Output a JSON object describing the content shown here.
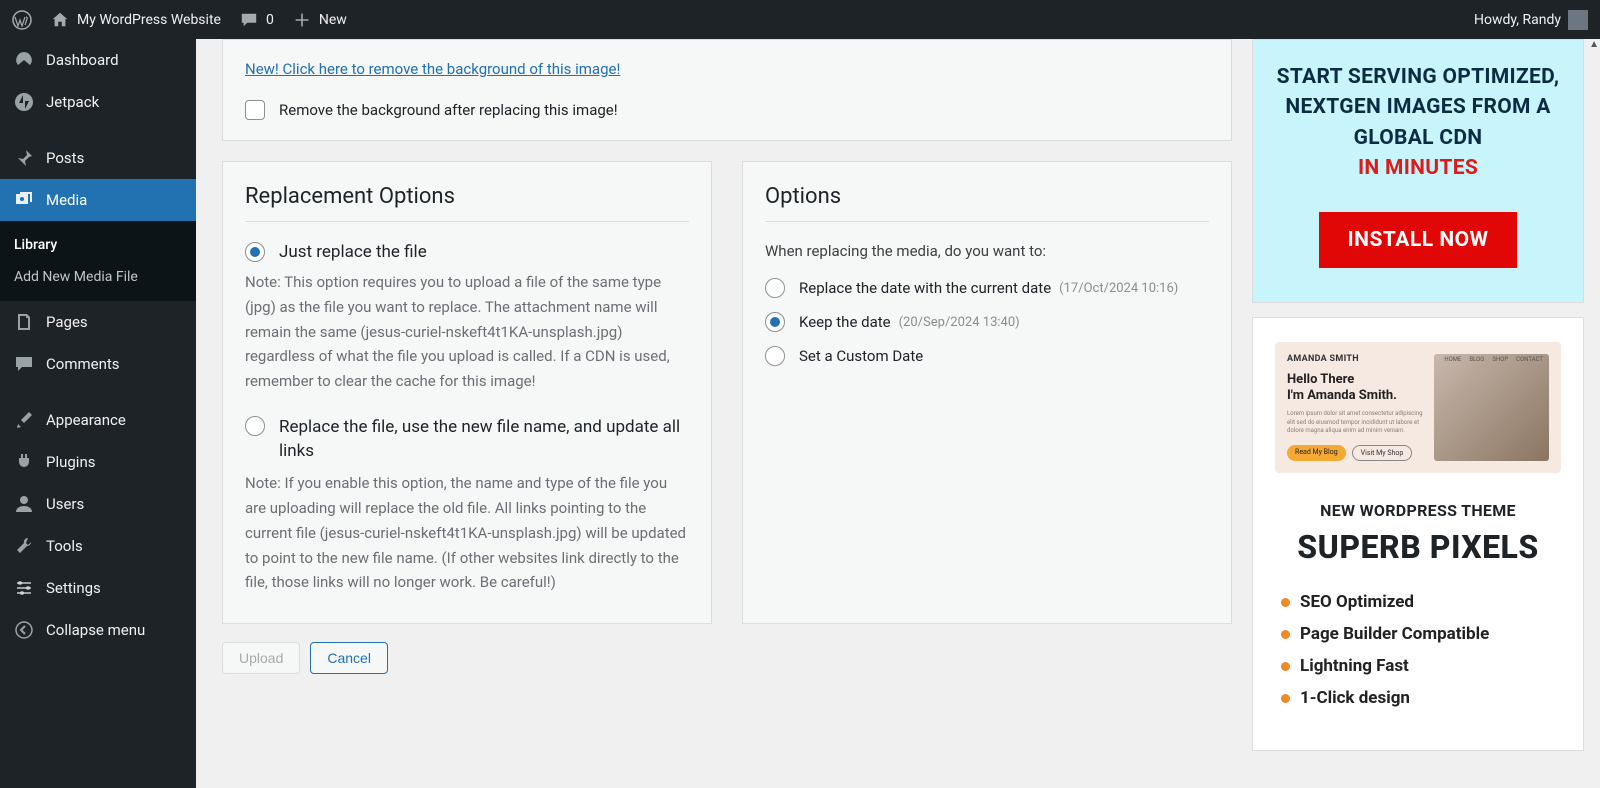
{
  "adminbar": {
    "site_name": "My WordPress Website",
    "comments_count": "0",
    "new_label": "New",
    "greeting": "Howdy, Randy"
  },
  "menu": {
    "dashboard": "Dashboard",
    "jetpack": "Jetpack",
    "posts": "Posts",
    "media": "Media",
    "media_sub_library": "Library",
    "media_sub_addnew": "Add New Media File",
    "pages": "Pages",
    "comments": "Comments",
    "appearance": "Appearance",
    "plugins": "Plugins",
    "users": "Users",
    "tools": "Tools",
    "settings": "Settings",
    "collapse": "Collapse menu"
  },
  "topbox": {
    "new_link": "New! Click here to remove the background of this image!",
    "remove_bg": "Remove the background after replacing this image!"
  },
  "replacement": {
    "heading": "Replacement Options",
    "opt1_label": "Just replace the file",
    "opt1_note": "Note: This option requires you to upload a file of the same type (jpg) as the file you want to replace. The attachment name will remain the same (jesus-curiel-nskeft4t1KA-unsplash.jpg) regardless of what the file you upload is called. If a CDN is used, remember to clear the cache for this image!",
    "opt2_label": "Replace the file, use the new file name, and update all links",
    "opt2_note": "Note: If you enable this option, the name and type of the file you are uploading will replace the old file. All links pointing to the current file (jesus-curiel-nskeft4t1KA-unsplash.jpg) will be updated to point to the new file name. (If other websites link directly to the file, those links will no longer work. Be careful!)"
  },
  "options": {
    "heading": "Options",
    "lead": "When replacing the media, do you want to:",
    "opt1": "Replace the date with the current date",
    "opt1_date": "(17/Oct/2024 10:16)",
    "opt2": "Keep the date",
    "opt2_date": "(20/Sep/2024 13:40)",
    "opt3": "Set a Custom Date"
  },
  "actions": {
    "upload": "Upload",
    "cancel": "Cancel"
  },
  "ad1": {
    "line1": "START SERVING OPTIMIZED, NEXTGEN IMAGES FROM A GLOBAL CDN",
    "line2": "IN MINUTES",
    "button": "INSTALL NOW"
  },
  "ad2": {
    "mock_name": "AMANDA SMITH",
    "mock_nav": [
      "HOME",
      "BLOG",
      "SHOP",
      "CONTACT"
    ],
    "mock_hello1": "Hello There",
    "mock_hello2": "I'm Amanda Smith.",
    "mock_pill1": "Read My Blog",
    "mock_pill2": "Visit My Shop",
    "subheading": "NEW WORDPRESS THEME",
    "heading": "SUPERB PIXELS",
    "features": [
      "SEO Optimized",
      "Page Builder Compatible",
      "Lightning Fast",
      "1-Click design"
    ]
  }
}
